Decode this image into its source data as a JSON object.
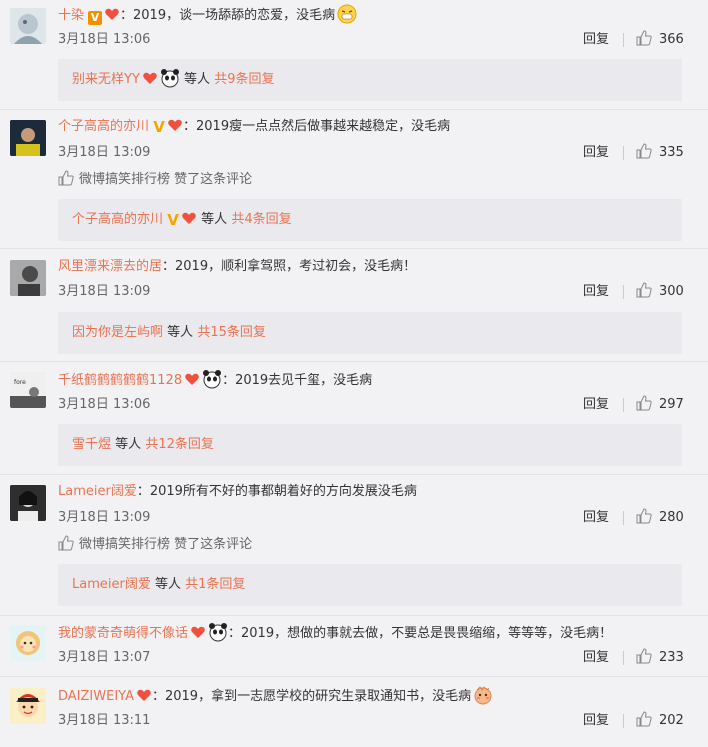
{
  "comments": [
    {
      "username": "十染",
      "text": "：2019，谈一场舔舔的恋爱，没毛病",
      "time": "3月18日 13:06",
      "reply": "回复",
      "likes": "366",
      "sub": {
        "names": "别来无样YY",
        "etc": "等人",
        "total": "共9条回复"
      }
    },
    {
      "username": "个子高高的亦川",
      "text": "：2019瘦一点点然后做事越来越稳定，没毛病",
      "time": "3月18日 13:09",
      "reply": "回复",
      "likes": "335",
      "liked_by": "微博搞笑排行榜 赞了这条评论",
      "sub": {
        "names": "个子高高的亦川",
        "etc": "等人",
        "total": "共4条回复"
      }
    },
    {
      "username": "风里漂来漂去的居",
      "text": "：2019，顺利拿驾照，考过初会，没毛病！",
      "time": "3月18日 13:09",
      "reply": "回复",
      "likes": "300",
      "sub": {
        "names": "因为你是左屿啊",
        "etc": "等人",
        "total": "共15条回复"
      }
    },
    {
      "username": "千纸鹤鹤鹤鹤鹤1128",
      "text": "：2019去见千玺，没毛病",
      "time": "3月18日 13:06",
      "reply": "回复",
      "likes": "297",
      "sub": {
        "names": "雪千煜",
        "etc": "等人",
        "total": "共12条回复"
      }
    },
    {
      "username": "Lameier阔爱",
      "text": "：2019所有不好的事都朝着好的方向发展没毛病",
      "time": "3月18日 13:09",
      "reply": "回复",
      "likes": "280",
      "liked_by": "微博搞笑排行榜 赞了这条评论",
      "sub": {
        "names": "Lameier阔爱",
        "etc": "等人",
        "total": "共1条回复"
      }
    },
    {
      "username": "我的蒙奇奇萌得不像话",
      "text": "：2019，想做的事就去做，不要总是畏畏缩缩，等等等，没毛病！",
      "time": "3月18日 13:07",
      "reply": "回复",
      "likes": "233"
    },
    {
      "username": "DAIZIWEIYA",
      "text": "：2019，拿到一志愿学校的研究生录取通知书，没毛病",
      "time": "3月18日 13:11",
      "reply": "回复",
      "likes": "202"
    }
  ]
}
